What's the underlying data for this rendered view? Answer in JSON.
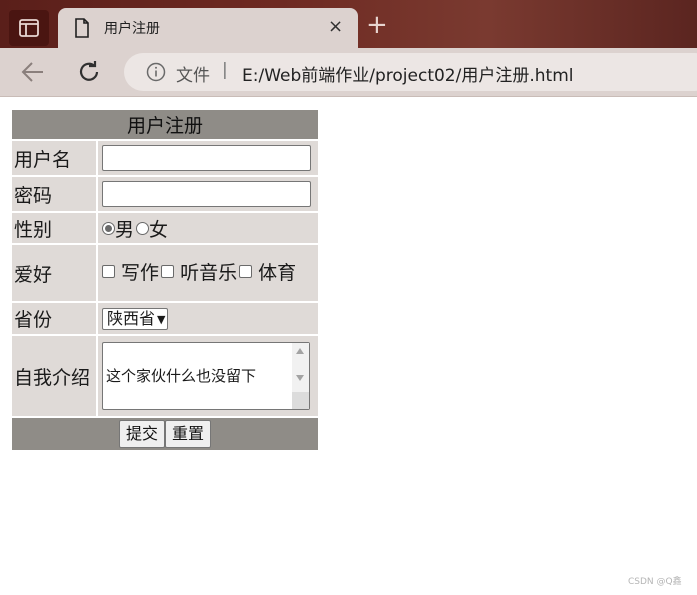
{
  "browser": {
    "tab_title": "用户注册",
    "tab_close": "×",
    "new_tab": "+",
    "address_label": "文件",
    "address_separator": "|",
    "address_url": "E:/Web前端作业/project02/用户注册.html"
  },
  "form": {
    "title": "用户注册",
    "username_label": "用户名",
    "username_value": "",
    "password_label": "密码",
    "password_value": "",
    "gender_label": "性别",
    "gender_options": [
      "男",
      "女"
    ],
    "gender_selected": "男",
    "hobby_label": "爱好",
    "hobby_options": [
      "写作",
      "听音乐",
      "体育"
    ],
    "province_label": "省份",
    "province_selected": "陕西省",
    "intro_label": "自我介绍",
    "intro_value": "这个家伙什么也没留下",
    "submit_label": "提交",
    "reset_label": "重置"
  },
  "watermark": "CSDN @Q鑫",
  "colors": {
    "header_bg": "#8f8c87",
    "cell_bg": "#dfdad7",
    "browser_frame": "#6e2a22",
    "toolbar": "#dcd2cf"
  }
}
